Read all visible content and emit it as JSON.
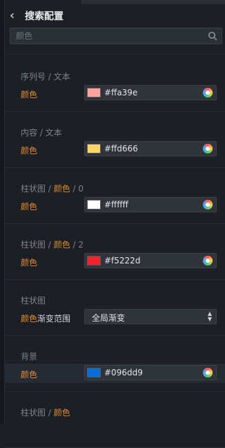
{
  "header": {
    "back_icon": "chevron-left-icon",
    "title": "搜索配置"
  },
  "search": {
    "placeholder": "颜色",
    "value": "",
    "icon": "search-icon"
  },
  "sections": [
    {
      "title_parts": [
        {
          "text": "序列号 / 文本",
          "accent": false
        }
      ],
      "label": "颜色",
      "label_suffix": "",
      "type": "color",
      "hex": "#ffa39e",
      "swatch": "#ffa39e"
    },
    {
      "title_parts": [
        {
          "text": "内容 / 文本",
          "accent": false
        }
      ],
      "label": "颜色",
      "label_suffix": "",
      "type": "color",
      "hex": "#ffd666",
      "swatch": "#ffd666"
    },
    {
      "title_parts": [
        {
          "text": "柱状图 / ",
          "accent": false
        },
        {
          "text": "颜色",
          "accent": true
        },
        {
          "text": " / 0",
          "accent": false
        }
      ],
      "label": "颜色",
      "label_suffix": "",
      "type": "color",
      "hex": "#ffffff",
      "swatch": "#ffffff"
    },
    {
      "title_parts": [
        {
          "text": "柱状图 / ",
          "accent": false
        },
        {
          "text": "颜色",
          "accent": true
        },
        {
          "text": " / 2",
          "accent": false
        }
      ],
      "label": "颜色",
      "label_suffix": "",
      "type": "color",
      "hex": "#f5222d",
      "swatch": "#f5222d"
    },
    {
      "title_parts": [
        {
          "text": "柱状图",
          "accent": false
        }
      ],
      "label": "颜色",
      "label_suffix": "渐变范围",
      "type": "select",
      "value": "全局渐变"
    },
    {
      "title_parts": [
        {
          "text": "背景",
          "accent": false
        }
      ],
      "label": "颜色",
      "label_suffix": "",
      "type": "color",
      "hex": "#096dd9",
      "swatch": "#096dd9",
      "highlighted": true
    },
    {
      "title_parts": [
        {
          "text": "柱状图 / ",
          "accent": false
        },
        {
          "text": "颜色",
          "accent": true
        }
      ],
      "label": "",
      "label_suffix": "",
      "type": "none"
    }
  ],
  "colors": {
    "accent": "#e58b2e",
    "background": "#1c1f24"
  }
}
